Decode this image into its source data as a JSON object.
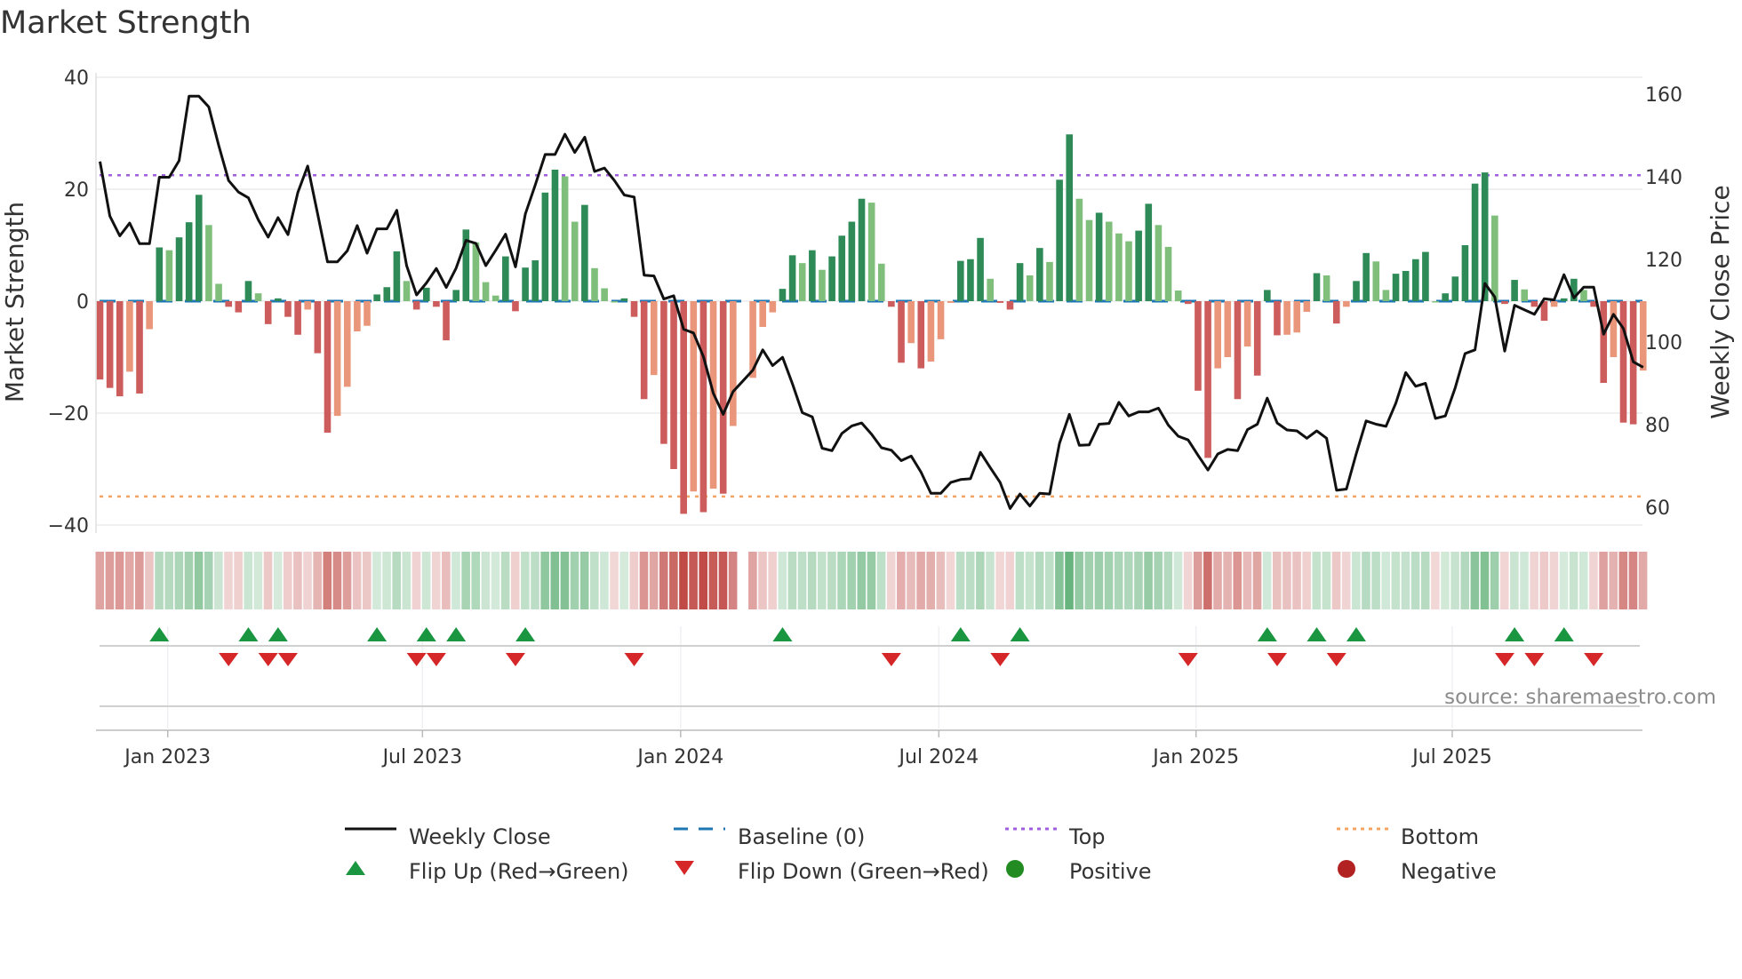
{
  "title": "Market Strength",
  "source": "source: sharemaestro.com",
  "colors": {
    "green_dark": "#2e8b57",
    "green_light": "#7fbf7b",
    "red_dark": "#cd5c5c",
    "red_light": "#e9967a",
    "line": "#111111",
    "baseline": "#1f77b4",
    "top": "#a05fdc",
    "bottom": "#f4a460",
    "flip_up": "#1a9641",
    "flip_down": "#d62728",
    "positive": "#228b22",
    "negative": "#b22222"
  },
  "legend": [
    {
      "key": "weekly_close",
      "label": "Weekly Close"
    },
    {
      "key": "baseline",
      "label": "Baseline (0)"
    },
    {
      "key": "top",
      "label": "Top"
    },
    {
      "key": "bottom",
      "label": "Bottom"
    },
    {
      "key": "flip_up",
      "label": "Flip Up (Red→Green)"
    },
    {
      "key": "flip_down",
      "label": "Flip Down (Green→Red)"
    },
    {
      "key": "positive",
      "label": "Positive"
    },
    {
      "key": "negative",
      "label": "Negative"
    }
  ],
  "chart_data": {
    "type": "bar+line",
    "title": "Market Strength",
    "ylabel": "Market Strength",
    "y2label": "Weekly Close Price",
    "ylim": [
      -40,
      40
    ],
    "y2lim": [
      60,
      160
    ],
    "yticks": [
      "40",
      "20",
      "0",
      "−20",
      "−40"
    ],
    "ytick_values": [
      40,
      20,
      0,
      -20,
      -40
    ],
    "y2ticks": [
      "160",
      "140",
      "120",
      "100",
      "80",
      "60"
    ],
    "y2tick_values": [
      160,
      140,
      120,
      100,
      80,
      60
    ],
    "top_level": 22.5,
    "bottom_level": -34.9,
    "baseline": 0,
    "x_ticks": [
      {
        "label": "Jan 2023",
        "week": 6.85
      },
      {
        "label": "Jul 2023",
        "week": 32.6
      },
      {
        "label": "Jan 2024",
        "week": 58.7
      },
      {
        "label": "Jul 2024",
        "week": 84.8
      },
      {
        "label": "Jan 2025",
        "week": 110.8
      },
      {
        "label": "Jul 2025",
        "week": 136.7
      }
    ],
    "strength": [
      -14,
      -15.5,
      -17,
      -12.6,
      -16.5,
      -5,
      9.6,
      9.1,
      11.4,
      14.1,
      19,
      13.6,
      3.1,
      -1,
      -2,
      3.6,
      1.4,
      -4.1,
      0.5,
      -2.8,
      -6,
      -1.5,
      -9.3,
      -23.5,
      -20.5,
      -15.3,
      -5.4,
      -4.4,
      1.2,
      2.5,
      8.9,
      3.6,
      -1.5,
      2.4,
      -1,
      -7,
      2,
      12.8,
      10.5,
      3.4,
      1,
      8,
      -1.8,
      6,
      7.3,
      19.4,
      23.5,
      22.3,
      14.2,
      17.2,
      5.9,
      2.3,
      0,
      0.5,
      -2.8,
      -17.5,
      -13.2,
      -25.5,
      -30,
      -38,
      -34,
      -37.7,
      -33.5,
      -34.4,
      -22.3,
      null,
      -13.7,
      -4.6,
      -2,
      2.2,
      8.2,
      6.8,
      9.1,
      5.6,
      8,
      11.7,
      14.2,
      18.3,
      17.6,
      6.7,
      -1,
      -11,
      -7.5,
      -12,
      -10.8,
      -6.8,
      -0.3,
      7.2,
      7.5,
      11.3,
      4,
      -0.3,
      -1.5,
      6.8,
      4.6,
      9.5,
      7,
      21.7,
      29.8,
      18.3,
      14.5,
      15.8,
      14.2,
      12.1,
      10.7,
      12.6,
      17.4,
      13.6,
      9.7,
      1.9,
      -0.5,
      -16,
      -28,
      -12,
      -10,
      -17.5,
      -8.1,
      -13.3,
      2,
      -6.1,
      -6,
      -5.6,
      -1.9,
      5,
      4.6,
      -4,
      -1,
      3.6,
      8.6,
      7.1,
      2,
      4.9,
      5.4,
      7.5,
      8.8,
      0,
      1.4,
      4.4,
      10,
      21,
      23,
      15.3,
      -0.5,
      3.8,
      2.1,
      -1,
      -3.5,
      -1,
      0.5,
      4,
      2,
      -1,
      -14.6,
      -10,
      -21.7,
      -22,
      -12.4
    ],
    "weekly_close": [
      143.7,
      130.5,
      125.7,
      128.8,
      123.8,
      123.8,
      139.9,
      139.9,
      143.9,
      159.5,
      159.5,
      156.9,
      147.6,
      139.1,
      136.3,
      134.9,
      129.6,
      125.4,
      130.1,
      126,
      136.2,
      142.6,
      131,
      119.4,
      119.4,
      122.1,
      128.2,
      121.5,
      127.4,
      127.4,
      131.9,
      118.5,
      111.4,
      114.3,
      117.8,
      113.2,
      117.9,
      124.6,
      123.9,
      118.5,
      122.2,
      126.1,
      118.2,
      131,
      138,
      145.4,
      145.4,
      150.3,
      145.9,
      149.6,
      141.3,
      142.1,
      139.1,
      135.6,
      135.1,
      116.2,
      116,
      110.4,
      111.2,
      103.1,
      102.2,
      96.5,
      87.6,
      82.5,
      88,
      90.6,
      93.2,
      98.1,
      94.3,
      96.3,
      89.9,
      82.9,
      81.9,
      74.3,
      73.7,
      77.9,
      79.7,
      80.4,
      77.7,
      74.4,
      73.8,
      71.3,
      72.4,
      68.5,
      63.4,
      63.4,
      66,
      66.7,
      66.9,
      73.3,
      69.6,
      66,
      59.7,
      63.2,
      60.3,
      63.4,
      63.2,
      75.5,
      82.5,
      75,
      75.1,
      80.1,
      80.3,
      85.4,
      82.1,
      83.1,
      83.1,
      84,
      79.9,
      77.2,
      76.3,
      72.6,
      69,
      72.9,
      74,
      73.7,
      78.8,
      80.1,
      86.4,
      80.4,
      78.7,
      78.5,
      76.7,
      78.5,
      76.7,
      64.1,
      64.4,
      73,
      80.9,
      80.1,
      79.6,
      85.2,
      92.6,
      89.3,
      90,
      81.5,
      82.1,
      88.9,
      97.2,
      98.1,
      114.2,
      110.9,
      97.8,
      108.9,
      107.8,
      106.7,
      110.5,
      110.2,
      116.3,
      110.7,
      113.3,
      113.3,
      101.9,
      106.7,
      103.3,
      95.2,
      93.9
    ],
    "flip_up_weeks": [
      6,
      15,
      18,
      28,
      33,
      36,
      43,
      69,
      87,
      93,
      118,
      123,
      127,
      143,
      148
    ],
    "flip_down_weeks": [
      13,
      17,
      19,
      32,
      34,
      42,
      54,
      80,
      91,
      110,
      119,
      125,
      142,
      145,
      151
    ]
  }
}
